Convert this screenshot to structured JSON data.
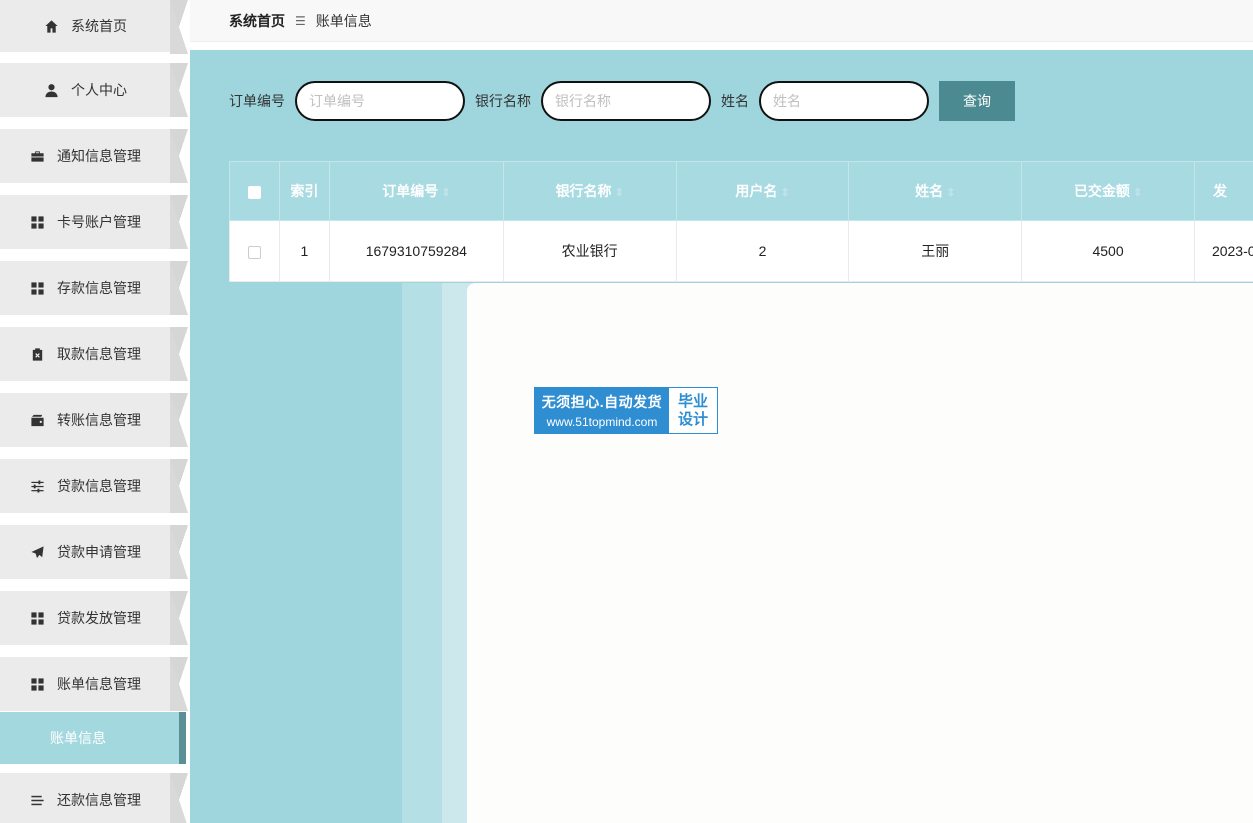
{
  "sidebar": {
    "items": [
      {
        "label": "系统首页",
        "icon": "home-icon"
      },
      {
        "label": "个人中心",
        "icon": "user-icon"
      },
      {
        "label": "通知信息管理",
        "icon": "briefcase-icon"
      },
      {
        "label": "卡号账户管理",
        "icon": "grid-icon"
      },
      {
        "label": "存款信息管理",
        "icon": "grid-icon"
      },
      {
        "label": "取款信息管理",
        "icon": "clipboard-x-icon"
      },
      {
        "label": "转账信息管理",
        "icon": "wallet-icon"
      },
      {
        "label": "贷款信息管理",
        "icon": "sliders-icon"
      },
      {
        "label": "贷款申请管理",
        "icon": "send-icon"
      },
      {
        "label": "贷款发放管理",
        "icon": "grid-icon"
      },
      {
        "label": "账单信息管理",
        "icon": "grid-icon"
      },
      {
        "label": "还款信息管理",
        "icon": "list-icon"
      }
    ],
    "active_sub": "账单信息"
  },
  "breadcrumb": {
    "home": "系统首页",
    "separator": "☰",
    "current": "账单信息"
  },
  "search": {
    "order_label": "订单编号",
    "order_placeholder": "订单编号",
    "bank_label": "银行名称",
    "bank_placeholder": "银行名称",
    "name_label": "姓名",
    "name_placeholder": "姓名",
    "query_button": "查询"
  },
  "table": {
    "headers": [
      "索引",
      "订单编号",
      "银行名称",
      "用户名",
      "姓名",
      "已交金额",
      "发"
    ],
    "rows": [
      [
        "1",
        "1679310759284",
        "农业银行",
        "2",
        "王丽",
        "4500",
        "2023-0"
      ]
    ]
  },
  "badge": {
    "line1": "无须担心.自动发货",
    "line2": "www.51topmind.com",
    "right1": "毕业",
    "right2": "设计"
  },
  "colors": {
    "main_bg": "#9fd6dd",
    "button": "#4b8a91",
    "active_sub": "#a4d8df",
    "badge": "#2f8ed1"
  }
}
